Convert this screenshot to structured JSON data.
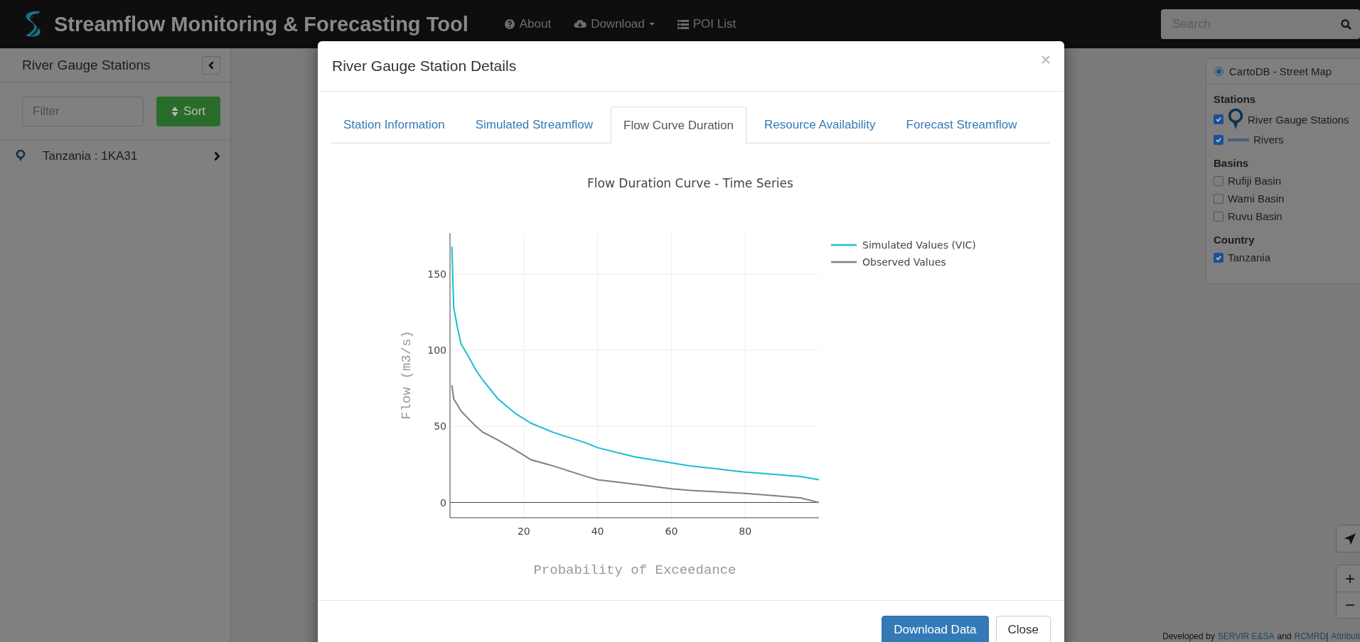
{
  "header": {
    "title": "Streamflow Monitoring & Forecasting Tool",
    "nav": [
      {
        "label": "About",
        "kind": "about"
      },
      {
        "label": "Download",
        "kind": "download"
      },
      {
        "label": "POI List",
        "kind": "list"
      }
    ],
    "search": {
      "placeholder": "Search"
    }
  },
  "sidebar": {
    "title": "River Gauge Stations",
    "filter": {
      "placeholder": "Filter"
    },
    "sort_button": "Sort",
    "stations": [
      "Tanzania : 1KA31"
    ]
  },
  "layers": {
    "base_layers": [
      {
        "label": "CartoDB - Street Map",
        "selected": true
      }
    ],
    "groups": [
      {
        "title": "Stations",
        "items": [
          {
            "label": "River Gauge Stations",
            "checked": true,
            "kind": "pin"
          },
          {
            "label": "Rivers",
            "checked": true,
            "kind": "line"
          }
        ]
      },
      {
        "title": "Basins",
        "items": [
          {
            "label": "Rufiji Basin",
            "checked": false,
            "kind": "plain"
          },
          {
            "label": "Wami Basin",
            "checked": false,
            "kind": "plain"
          },
          {
            "label": "Ruvu Basin",
            "checked": false,
            "kind": "plain"
          }
        ]
      },
      {
        "title": "Country",
        "items": [
          {
            "label": "Tanzania",
            "checked": true,
            "kind": "plain"
          }
        ]
      }
    ]
  },
  "map_controls": {
    "zoom_in": "+",
    "zoom_out": "−"
  },
  "attribution": {
    "prefix": "Developed by",
    "link_1": "SERVIR E&SA",
    "joiner": "and",
    "link_2": "RCMRD",
    "separator": "|",
    "link_3": "Attributi"
  },
  "modal": {
    "title": "River Gauge Station Details",
    "close": "×",
    "tabs": [
      {
        "label": "Station Information",
        "selected": false
      },
      {
        "label": "Simulated Streamflow",
        "selected": false
      },
      {
        "label": "Flow Curve Duration",
        "selected": true
      },
      {
        "label": "Resource Availability",
        "selected": false
      },
      {
        "label": "Forecast Streamflow",
        "selected": false
      }
    ],
    "chart_data": {
      "type": "line",
      "title": "Flow Duration Curve - Time Series",
      "xlabel": "Probability of Exceedance",
      "ylabel": "Flow (m3/s)",
      "x": [
        0.5,
        1,
        2,
        3,
        5,
        7,
        9,
        13,
        18,
        22,
        28,
        37,
        40,
        50,
        60,
        65,
        80,
        85,
        95,
        100
      ],
      "series": [
        {
          "name": "Simulated Values (VIC)",
          "color": "#17becf",
          "values": [
            168,
            128,
            115,
            104,
            96,
            87,
            80,
            68,
            58,
            52,
            46,
            39,
            36,
            30,
            26,
            24,
            20,
            19,
            17,
            15
          ]
        },
        {
          "name": "Observed Values",
          "color": "#7f7f7f",
          "values": [
            77,
            68,
            64,
            60,
            55,
            50,
            46,
            41,
            34,
            28,
            24,
            17,
            15,
            12,
            9,
            8,
            6,
            5,
            3,
            0
          ]
        }
      ],
      "grid": true,
      "legend": true,
      "xlim": [
        0,
        100
      ],
      "ylim": [
        -10,
        177
      ],
      "xticks": [
        20,
        40,
        60,
        80
      ],
      "yticks": [
        0,
        50,
        100,
        150
      ]
    },
    "buttons": [
      {
        "label": "Download Data",
        "kind": "primary"
      },
      {
        "label": "Close",
        "kind": "default"
      }
    ]
  }
}
